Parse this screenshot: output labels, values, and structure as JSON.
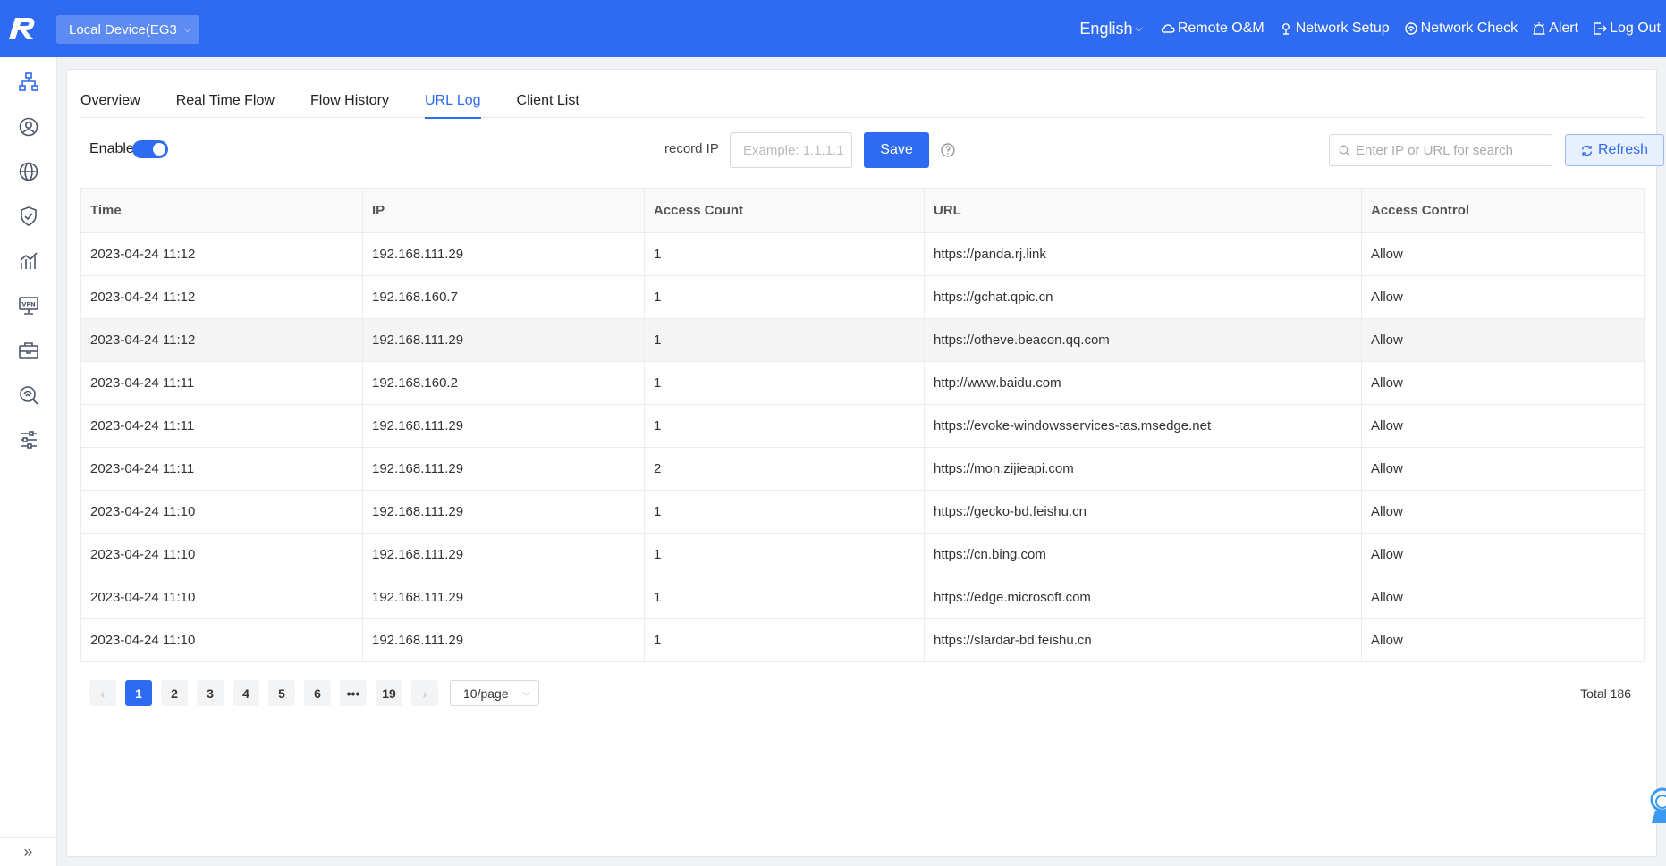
{
  "header": {
    "device_select": "Local Device(EG3",
    "nav": {
      "language": "English",
      "remote_om": "Remote O&M",
      "network_setup": "Network Setup",
      "network_check": "Network Check",
      "alert": "Alert",
      "logout": "Log Out"
    }
  },
  "sidebar": {
    "icons": [
      "topology-icon",
      "user-icon",
      "globe-icon",
      "shield-icon",
      "chart-icon",
      "vpn-icon",
      "toolbox-icon",
      "diagnose-icon",
      "settings-sliders-icon"
    ]
  },
  "tabs": [
    "Overview",
    "Real Time Flow",
    "Flow History",
    "URL Log",
    "Client List"
  ],
  "active_tab": "URL Log",
  "toolbar": {
    "enable_label": "Enable",
    "enable_on": true,
    "record_ip_label": "record IP",
    "record_ip_placeholder": "Example: 1.1.1.1",
    "save_label": "Save",
    "search_placeholder": "Enter IP or URL for search",
    "refresh_label": "Refresh"
  },
  "table": {
    "columns": [
      "Time",
      "IP",
      "Access Count",
      "URL",
      "Access Control"
    ],
    "rows": [
      [
        "2023-04-24 11:12",
        "192.168.111.29",
        "1",
        "https://panda.rj.link",
        "Allow"
      ],
      [
        "2023-04-24 11:12",
        "192.168.160.7",
        "1",
        "https://gchat.qpic.cn",
        "Allow"
      ],
      [
        "2023-04-24 11:12",
        "192.168.111.29",
        "1",
        "https://otheve.beacon.qq.com",
        "Allow"
      ],
      [
        "2023-04-24 11:11",
        "192.168.160.2",
        "1",
        "http://www.baidu.com",
        "Allow"
      ],
      [
        "2023-04-24 11:11",
        "192.168.111.29",
        "1",
        "https://evoke-windowsservices-tas.msedge.net",
        "Allow"
      ],
      [
        "2023-04-24 11:11",
        "192.168.111.29",
        "2",
        "https://mon.zijieapi.com",
        "Allow"
      ],
      [
        "2023-04-24 11:10",
        "192.168.111.29",
        "1",
        "https://gecko-bd.feishu.cn",
        "Allow"
      ],
      [
        "2023-04-24 11:10",
        "192.168.111.29",
        "1",
        "https://cn.bing.com",
        "Allow"
      ],
      [
        "2023-04-24 11:10",
        "192.168.111.29",
        "1",
        "https://edge.microsoft.com",
        "Allow"
      ],
      [
        "2023-04-24 11:10",
        "192.168.111.29",
        "1",
        "https://slardar-bd.feishu.cn",
        "Allow"
      ]
    ],
    "highlighted_row": 2
  },
  "pagination": {
    "pages": [
      "1",
      "2",
      "3",
      "4",
      "5",
      "6",
      "•••",
      "19"
    ],
    "current": "1",
    "page_size": "10/page",
    "total": "Total 186"
  },
  "colors": {
    "brand": "#2f6bf0"
  }
}
